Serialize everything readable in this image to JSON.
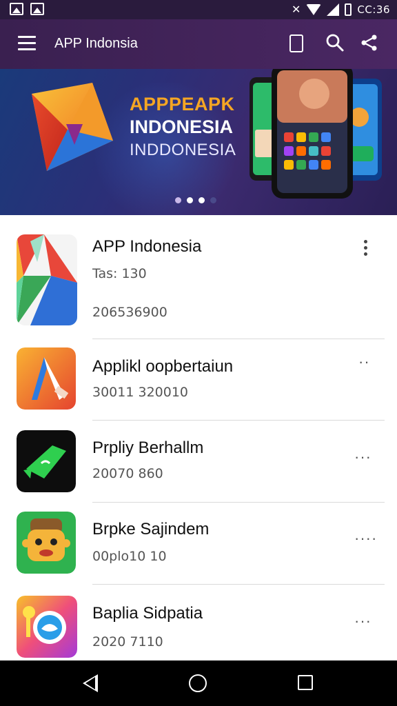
{
  "status_bar": {
    "time": "CC:36"
  },
  "app_bar": {
    "title": "APP Indonsia"
  },
  "banner": {
    "line1": "APPPEAPK",
    "line2": "INDONESIA",
    "line3": "INDDONESIA",
    "carousel": {
      "slides": 4,
      "active": 2
    }
  },
  "apps": [
    {
      "name": "APP Indonesia",
      "sub": "Tas: 130",
      "sub2": "206536900",
      "icon": "triangle-logo-icon"
    },
    {
      "name": "Applikl oopbertaiun",
      "sub": "30011 320010",
      "icon": "pen-tool-icon"
    },
    {
      "name": "Prpliy Berhallm",
      "sub": "20070 860",
      "icon": "green-arrow-icon"
    },
    {
      "name": "Brpke Sajindem",
      "sub": "00plo10 10",
      "icon": "game-character-icon"
    },
    {
      "name": "Baplia Sidpatia",
      "sub": "2020 7110",
      "icon": "colorful-bird-icon"
    }
  ],
  "colors": {
    "app_bar": "#4a2763",
    "banner_accent": "#f5a623"
  }
}
